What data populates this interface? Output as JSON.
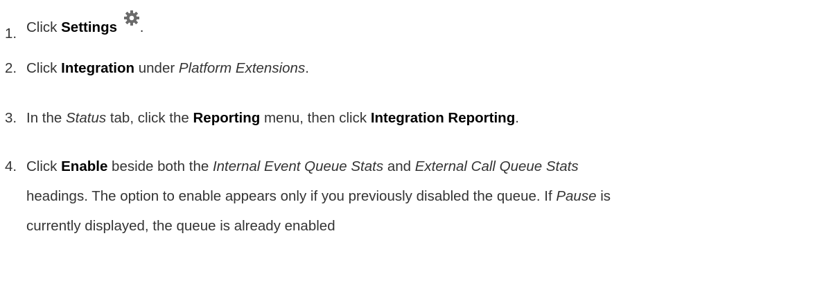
{
  "steps": [
    {
      "number": "1.",
      "pre": "Click",
      "bold1": "Settings",
      "icon": "gear-icon",
      "post": "."
    },
    {
      "number": "2.",
      "pre": "Click",
      "bold1": "Integration",
      "mid": "under",
      "italic1": "Platform Extensions",
      "post": "."
    },
    {
      "number": "3.",
      "pre": "In the",
      "italic1": "Status",
      "mid1": "tab, click the",
      "bold1": "Reporting",
      "mid2": "menu, then click",
      "bold2": "Integration Reporting",
      "post": "."
    },
    {
      "number": "4.",
      "pre": "Click",
      "bold1": "Enable",
      "mid1": "beside both the",
      "italic1": "Internal Event Queue Stats",
      "mid2": "and",
      "italic2": "External Call Queue Stats",
      "line2_pre": "headings. The option to enable appears only if you previously disabled the queue. If",
      "italic3": "Pause",
      "line2_post": "is",
      "line3": "currently displayed, the queue is already enabled"
    }
  ],
  "colors": {
    "text": "#333333",
    "bold": "#000000",
    "icon": "#6b6b6b"
  }
}
